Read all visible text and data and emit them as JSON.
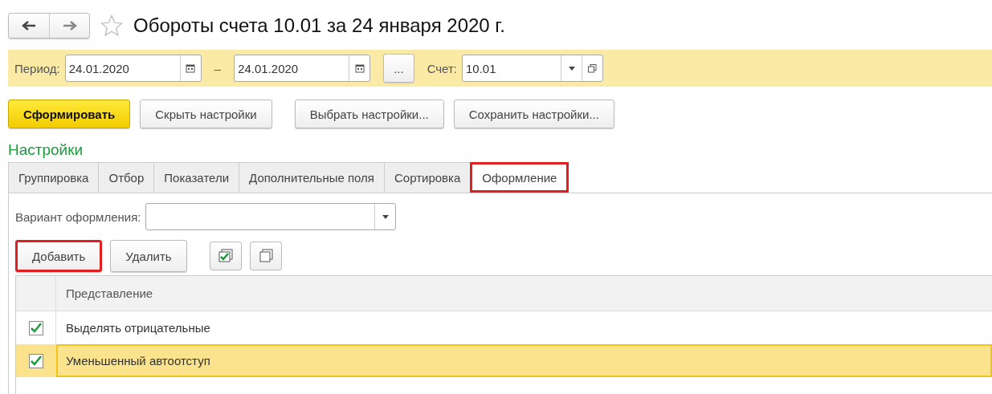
{
  "title": "Обороты счета 10.01 за 24 января 2020 г.",
  "filter_bar": {
    "period_label": "Период:",
    "date_from": "24.01.2020",
    "separator": "–",
    "date_to": "24.01.2020",
    "more_button": "...",
    "account_label": "Счет:",
    "account": "10.01"
  },
  "actions": [
    {
      "label": "Сформировать",
      "kind": "primary"
    },
    {
      "label": "Скрыть настройки",
      "kind": "normal"
    },
    {
      "label": "Выбрать настройки...",
      "kind": "normal"
    },
    {
      "label": "Сохранить настройки...",
      "kind": "normal"
    }
  ],
  "settings_title": "Настройки",
  "tabs": [
    {
      "label": "Группировка",
      "selected": false,
      "highlighted": false
    },
    {
      "label": "Отбор",
      "selected": false,
      "highlighted": false
    },
    {
      "label": "Показатели",
      "selected": false,
      "highlighted": false
    },
    {
      "label": "Дополнительные поля",
      "selected": false,
      "highlighted": false
    },
    {
      "label": "Сортировка",
      "selected": false,
      "highlighted": false
    },
    {
      "label": "Оформление",
      "selected": true,
      "highlighted": true
    }
  ],
  "variant_label": "Вариант оформления:",
  "toolbar": [
    {
      "label": "Добавить",
      "highlighted": true
    },
    {
      "label": "Удалить",
      "highlighted": false
    }
  ],
  "table": {
    "columns": [
      "Представление"
    ],
    "rows": [
      {
        "checked": true,
        "text": "Выделять отрицательные",
        "selected": false
      },
      {
        "checked": true,
        "text": "Уменьшенный автоотступ",
        "selected": true
      }
    ]
  }
}
